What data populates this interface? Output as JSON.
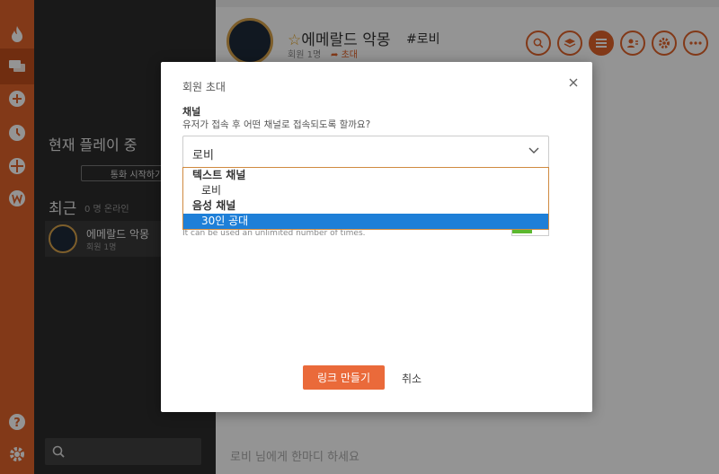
{
  "sidebar": {
    "now_playing": "현재 플레이 중",
    "start_call": "통화 시작하기",
    "recent": "최근",
    "online_count": "0 명 온라인",
    "room_name": "에메랄드 악몽",
    "room_members": "회원 1명"
  },
  "header": {
    "title": "에메랄드 악몽",
    "channel": "#로비",
    "members": "회원 1명",
    "invite": "초대"
  },
  "chat": {
    "placeholder": "로비 님에게 한마디 하세요"
  },
  "modal": {
    "title": "회원 초대",
    "channel_label": "채널",
    "channel_desc": "유저가 접속 후 어떤 채널로 접속되도록 할까요?",
    "selected": "로비",
    "groups": [
      {
        "label": "텍스트 채널",
        "options": [
          "로비"
        ]
      },
      {
        "label": "음성 채널",
        "options": [
          "30인 공대"
        ]
      }
    ],
    "unlimited_note": "It can be used an unlimited number of times.",
    "create_button": "링크 만들기",
    "cancel_button": "취소"
  },
  "colors": {
    "accent": "#e0622a",
    "selection": "#1e7fd8",
    "toggle_on": "#5cb82e"
  }
}
